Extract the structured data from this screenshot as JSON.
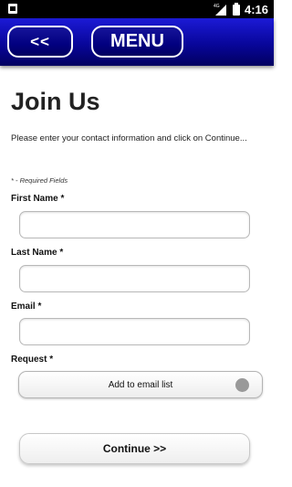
{
  "status_bar": {
    "time": "4:16",
    "icons": [
      "notification-icon",
      "signal-4g-icon",
      "battery-icon"
    ]
  },
  "header": {
    "back_label": "<<",
    "menu_label": "MENU"
  },
  "page": {
    "title": "Join Us",
    "intro": "Please enter your contact information and click on Continue...",
    "required_note": "* - Required Fields"
  },
  "form": {
    "first_name": {
      "label": "First Name *",
      "value": ""
    },
    "last_name": {
      "label": "Last Name *",
      "value": ""
    },
    "email": {
      "label": "Email *",
      "value": ""
    },
    "request": {
      "label": "Request *",
      "option_label": "Add to email list",
      "checked": false
    }
  },
  "actions": {
    "continue_label": "Continue >>"
  },
  "colors": {
    "header_blue": "#08069a",
    "status_bar": "#000000",
    "toggle_knob": "#999999"
  }
}
